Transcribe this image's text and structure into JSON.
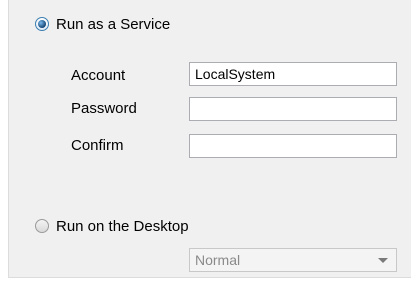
{
  "service_option": {
    "label": "Run as a Service",
    "selected": true
  },
  "fields": {
    "account": {
      "label": "Account",
      "value": "LocalSystem"
    },
    "password": {
      "label": "Password",
      "value": ""
    },
    "confirm": {
      "label": "Confirm",
      "value": ""
    }
  },
  "desktop_option": {
    "label": "Run on the Desktop",
    "selected": false,
    "window_mode": {
      "value": "Normal",
      "enabled": false,
      "icon": "chevron-down-icon"
    }
  }
}
